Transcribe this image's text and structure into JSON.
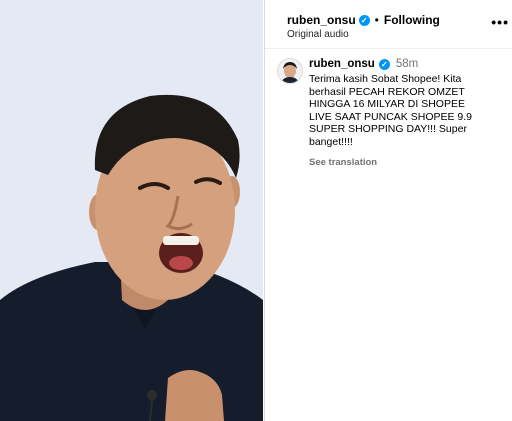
{
  "header": {
    "username": "ruben_onsu",
    "separator": "•",
    "follow_label": "Following",
    "audio_label": "Original audio",
    "more_label": "•••"
  },
  "post": {
    "username": "ruben_onsu",
    "time": "58m",
    "caption": "Terima kasih Sobat Shopee! Kita berhasil PECAH REKOR OMZET HINGGA 16 MILYAR DI SHOPEE LIVE SAAT PUNCAK SHOPEE 9.9 SUPER SHOPPING DAY!!! Super banget!!!!",
    "see_translation": "See translation"
  },
  "icons": {
    "verified": "verified-badge-icon",
    "more": "more-options-icon"
  },
  "colors": {
    "verified": "#0095f6",
    "secondary_text": "#737373",
    "shirt": "#151d2c",
    "background": "#e3e8f2"
  }
}
